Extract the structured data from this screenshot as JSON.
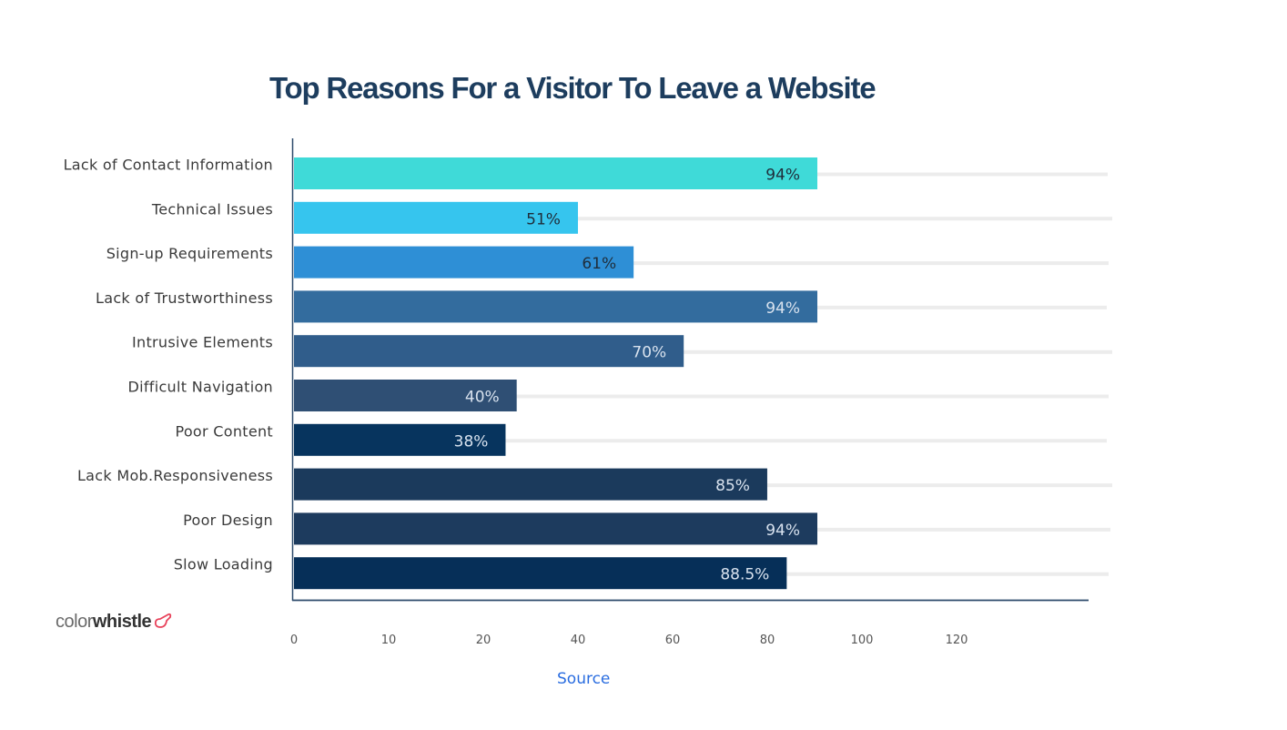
{
  "chart_data": {
    "type": "bar",
    "orientation": "horizontal",
    "title": "Top Reasons For a Visitor To Leave a Website",
    "xlabel": "",
    "ylabel": "",
    "categories": [
      "Lack of Contact Information",
      "Technical Issues",
      "Sign-up Requirements",
      "Lack of Trustworthiness",
      "Intrusive Elements",
      "Difficult Navigation",
      "Poor Content",
      "Lack Mob.Responsiveness",
      "Poor Design",
      "Slow Loading"
    ],
    "values": [
      94,
      51,
      61,
      94,
      70,
      40,
      38,
      85,
      94,
      88.5
    ],
    "value_labels": [
      "94%",
      "51%",
      "61%",
      "94%",
      "70%",
      "40%",
      "38%",
      "85%",
      "94%",
      "88.5%"
    ],
    "bar_colors": [
      "#3fdad8",
      "#36c5ee",
      "#2e8fd6",
      "#336c9e",
      "#305d8b",
      "#2f4f74",
      "#07345e",
      "#1b3a5c",
      "#1d3b5e",
      "#062f58"
    ],
    "value_label_colors": [
      "#1f2d3a",
      "#1f2d3a",
      "#1f2d3a",
      "#d8e2ee",
      "#d8e2ee",
      "#d8e2ee",
      "#d8e2ee",
      "#d8e2ee",
      "#d8e2ee",
      "#d8e2ee"
    ],
    "x_ticks": [
      "0",
      "10",
      "20",
      "40",
      "60",
      "80",
      "100",
      "120"
    ],
    "grid": true,
    "legend": "none"
  },
  "branding": {
    "logo_part1": "color",
    "logo_part2": "whistle",
    "logo_accent_color": "#e8425a"
  },
  "footer": {
    "source_label": "Source",
    "link_color": "#2a6de0"
  }
}
